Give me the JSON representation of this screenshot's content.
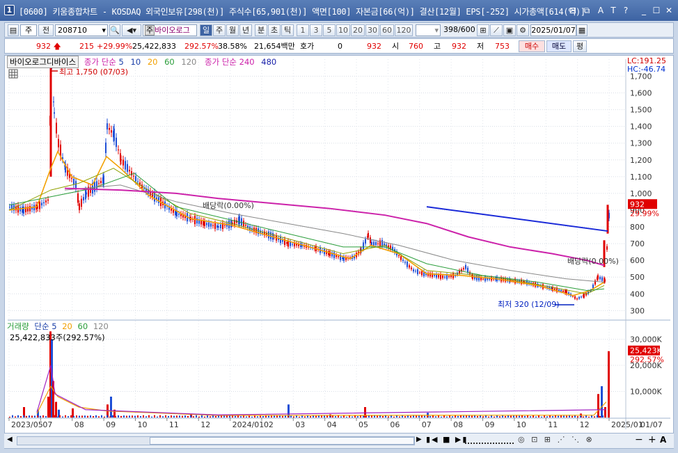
{
  "window": {
    "title": "[0600] 키움종합차트 - KOSDAQ 외국인보유[298(천)] 주식수[65,901(천)] 액면[100] 자본금[66(억)] 결산[12월] EPS[-252] 시가총액[614(억)]",
    "app_icon": "1",
    "controls": [
      "minimize-pane-icon",
      "restore-icon",
      "font-icon",
      "text-icon",
      "help-icon",
      "minimize-icon",
      "maximize-icon",
      "close-icon"
    ]
  },
  "toolbar": {
    "period_select": "주",
    "prev_label": "전",
    "stock_code": "208710",
    "stock_name": "바이오로그",
    "stock_name_prefix": "주",
    "period_buttons": [
      "일",
      "주",
      "월",
      "년",
      "분",
      "초",
      "틱"
    ],
    "active_period": "일",
    "interval_buttons": [
      "1",
      "3",
      "5",
      "10",
      "20",
      "30",
      "60",
      "120"
    ],
    "count": "398",
    "count_total": "/600",
    "date": "2025/01/07"
  },
  "quote": {
    "price": "932",
    "change": "215",
    "change_pct": "+29.99%",
    "volume": "25,422,833",
    "volume_ratio": "292.57%",
    "turnover": "38.58%",
    "amount": "21,654백만",
    "hoga_label": "호가",
    "hoga_value": "0",
    "hoga_price": "932",
    "open_label": "시",
    "open": "760",
    "high_label": "고",
    "high": "932",
    "low_label": "저",
    "low": "753",
    "buy_label": "매수",
    "sell_label": "매도",
    "avg_label": "평"
  },
  "price_panel": {
    "name_box": "바이오로그디바이스",
    "ma_label": "종가 단순",
    "ma_periods": [
      "5",
      "10",
      "20",
      "60",
      "120"
    ],
    "ma_label2": "종가 단순",
    "ma_periods2": [
      "240",
      "480"
    ],
    "lc": "LC:191.25",
    "hc": "HC:-46.74",
    "y_ticks": [
      "1,700",
      "1,600",
      "1,500",
      "1,400",
      "1,300",
      "1,200",
      "1,100",
      "1,000",
      "900",
      "800",
      "700",
      "600",
      "500",
      "400",
      "300"
    ],
    "price_tag": "932",
    "price_tag_pct": "29.99%",
    "annotation_high": "최고 1,750 (07/03)",
    "annotation_low": "최저 320 (12/09)",
    "ex_dividend_1": "배당락(0.00%)",
    "ex_dividend_2": "배당락(0.00%)"
  },
  "volume_panel": {
    "label": "거래량",
    "ma_label": "단순",
    "ma_periods": [
      "5",
      "20",
      "60",
      "120"
    ],
    "value_label": "25,422,833주(292.57%)",
    "y_ticks": [
      "30,000K",
      "20,000K",
      "10,000K"
    ],
    "tag": "25,423K",
    "tag_pct": "292.57%"
  },
  "x_axis": {
    "labels": [
      "2023/05",
      "07",
      "08",
      "09",
      "10",
      "11",
      "12",
      "2024/01",
      "02",
      "03",
      "04",
      "05",
      "06",
      "07",
      "08",
      "09",
      "10",
      "11",
      "12",
      "2025/01",
      "01/07"
    ]
  },
  "colors": {
    "up": "#e00000",
    "down": "#1f4fd6",
    "ma5": "#1a3fa8",
    "ma10": "#f2a000",
    "ma20": "#8fa000",
    "ma60": "#2a9d3a",
    "ma120": "#888888",
    "ma240": "#cc22aa",
    "ma480": "#1a22aa",
    "trendline": "#1a2ad8"
  }
}
